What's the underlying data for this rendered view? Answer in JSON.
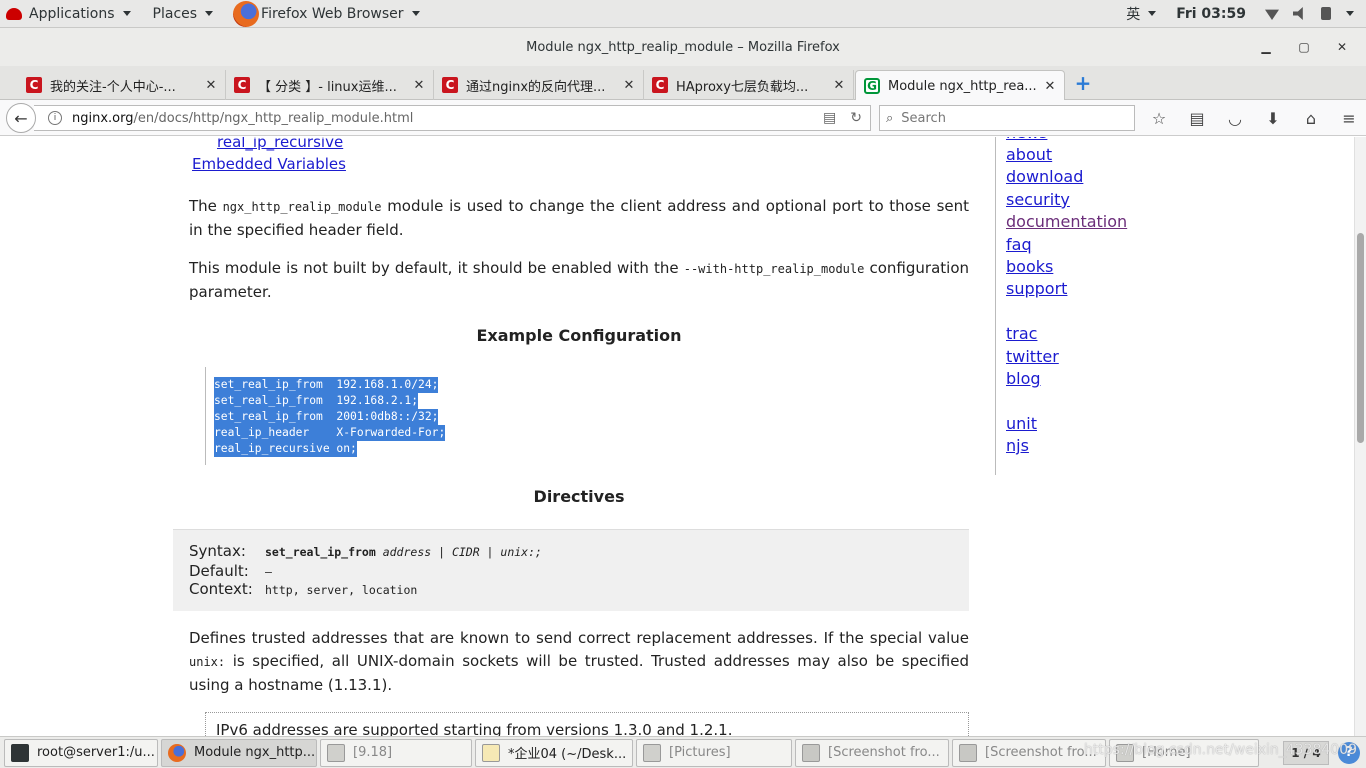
{
  "topbar": {
    "applications": "Applications",
    "places": "Places",
    "active_app": "Firefox Web Browser",
    "input_method": "英",
    "clock": "Fri 03:59"
  },
  "window": {
    "title": "Module ngx_http_realip_module – Mozilla Firefox"
  },
  "tabs": [
    {
      "label": "我的关注-个人中心-...",
      "favicon": "C"
    },
    {
      "label": "【 分类 】- linux运维...",
      "favicon": "C"
    },
    {
      "label": "通过nginx的反向代理...",
      "favicon": "C"
    },
    {
      "label": "HAproxy七层负载均...",
      "favicon": "C"
    },
    {
      "label": "Module ngx_http_rea...",
      "favicon": "G"
    }
  ],
  "navbar": {
    "url_domain": "nginx.org",
    "url_path": "/en/docs/http/ngx_http_realip_module.html",
    "search_placeholder": "Search"
  },
  "page": {
    "toc": [
      "real_ip_recursive",
      "Embedded Variables"
    ],
    "intro_prefix": "The ",
    "intro_code": "ngx_http_realip_module",
    "intro_suffix": " module is used to change the client address and optional port to those sent in the specified header field.",
    "build_prefix": "This module is not built by default, it should be enabled with the ",
    "build_code": "--with-http_realip_module",
    "build_suffix": " configuration parameter.",
    "example_heading": "Example Configuration",
    "code_lines": [
      "set_real_ip_from  192.168.1.0/24;",
      "set_real_ip_from  192.168.2.1;",
      "set_real_ip_from  2001:0db8::/32;",
      "real_ip_header    X-Forwarded-For;",
      "real_ip_recursive on;"
    ],
    "directives_heading": "Directives",
    "syntax_label": "Syntax:",
    "syntax_directive": "set_real_ip_from",
    "syntax_args": " address | CIDR | unix:;",
    "default_label": "Default:",
    "default_value": "—",
    "context_label": "Context:",
    "context_value": "http, server, location",
    "defines_text_1": "Defines trusted addresses that are known to send correct replacement addresses. If the special value ",
    "defines_code": "unix:",
    "defines_text_2": " is specified, all UNIX-domain sockets will be trusted. Trusted addresses may also be specified using a hostname (1.13.1).",
    "note_text": "IPv6 addresses are supported starting from versions 1.3.0 and 1.2.1."
  },
  "sidebar": {
    "links": [
      "news",
      "about",
      "download",
      "security",
      "documentation",
      "faq",
      "books",
      "support",
      "trac",
      "twitter",
      "blog",
      "unit",
      "njs"
    ]
  },
  "taskbar": {
    "items": [
      {
        "label": "root@server1:/u...",
        "icon": "terminal-icon"
      },
      {
        "label": "Module ngx_http...",
        "icon": "firefox-icon"
      },
      {
        "label": "[9.18]",
        "icon": "folder-icon"
      },
      {
        "label": "*企业04 (~/Desk...",
        "icon": "text-editor-icon"
      },
      {
        "label": "[Pictures]",
        "icon": "folder-icon"
      },
      {
        "label": "[Screenshot fro...",
        "icon": "screenshot-icon"
      },
      {
        "label": "[Screenshot fro...",
        "icon": "screenshot-icon"
      },
      {
        "label": "[Home]",
        "icon": "folder-icon"
      }
    ],
    "workspace": "1 / 4",
    "watermark": "https://blog.csdn.net/weixin_43384009"
  },
  "colors": {
    "link": "#1b1bcf",
    "visited_link": "#6b2e7a",
    "selection": "#3d7fd8",
    "tab_favicon_red": "#c9151e",
    "nginx_green": "#009639"
  }
}
